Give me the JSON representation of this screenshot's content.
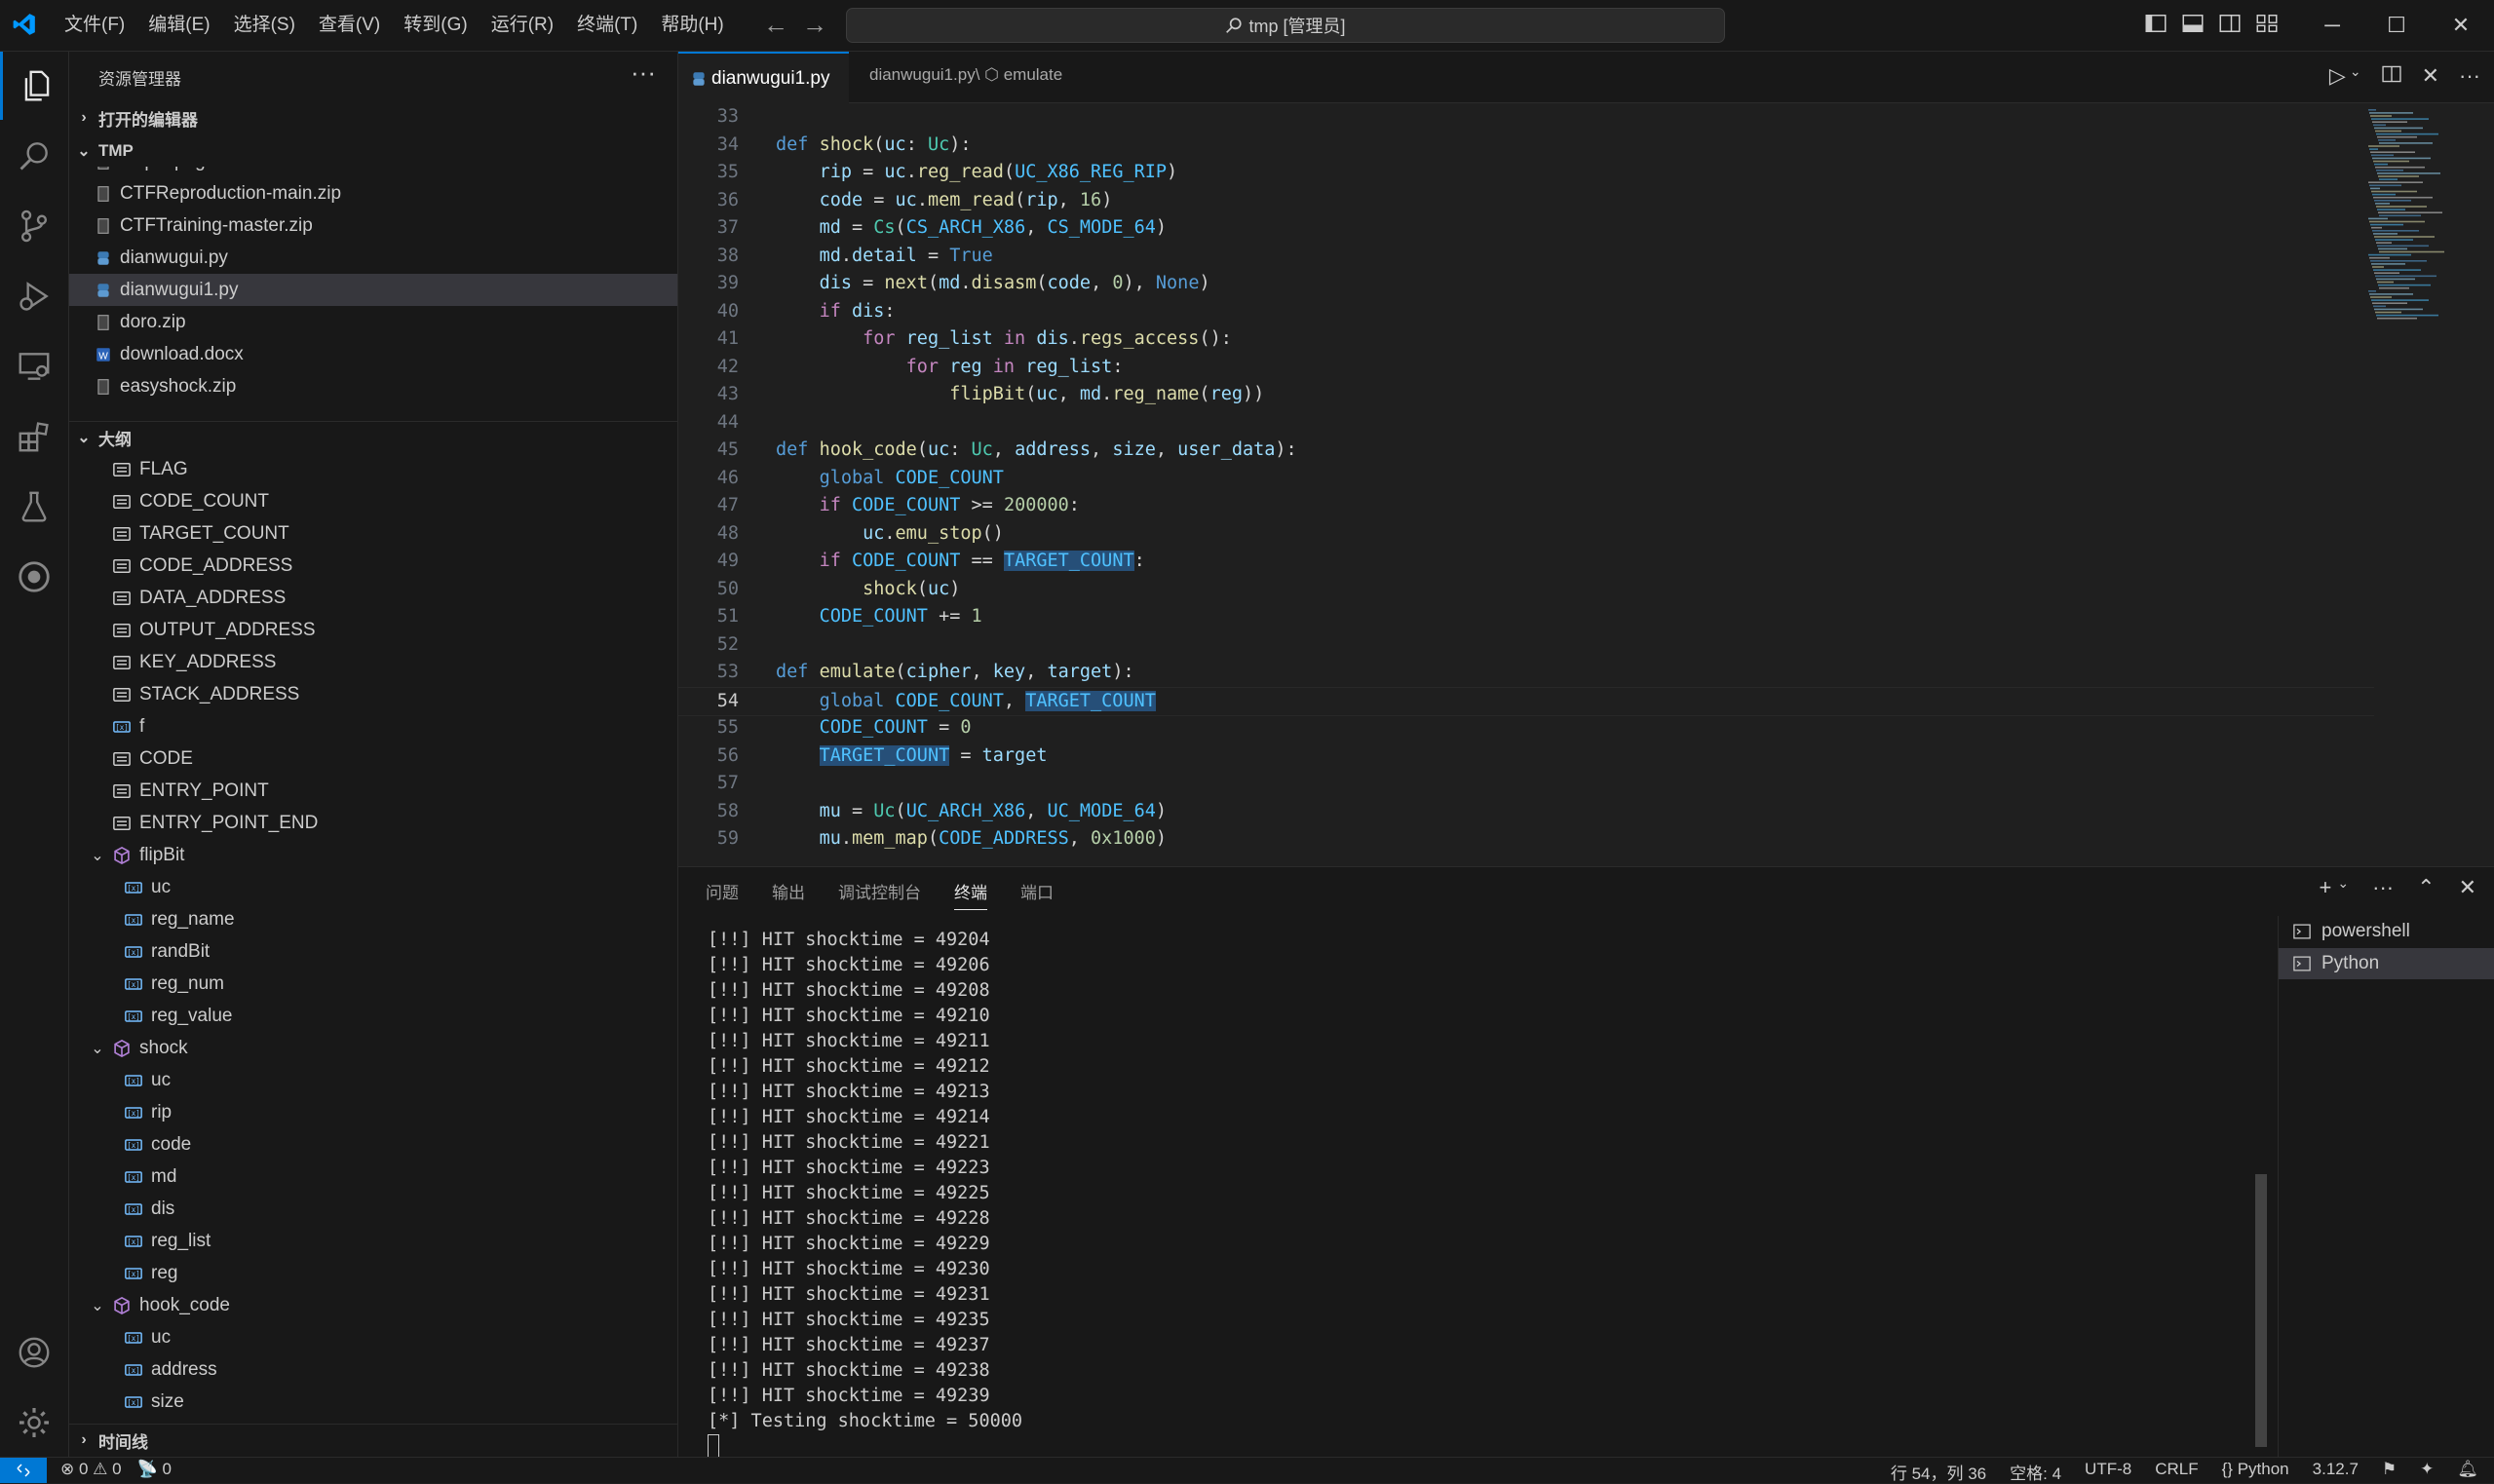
{
  "titlebar": {
    "menus": [
      "文件(F)",
      "编辑(E)",
      "选择(S)",
      "查看(V)",
      "转到(G)",
      "运行(R)",
      "终端(T)",
      "帮助(H)"
    ],
    "nav_back": "←",
    "nav_forward": "→",
    "command_center": "tmp [管理员]",
    "window_controls": [
      "─",
      "☐",
      "✕"
    ]
  },
  "sidebar": {
    "title": "资源管理器",
    "more": "···",
    "open_editors": "打开的编辑器",
    "folder": "TMP",
    "files": [
      {
        "name": "ctf.pcapng",
        "kind": "file"
      },
      {
        "name": "CTFReproduction-main.zip",
        "kind": "zip"
      },
      {
        "name": "CTFTraining-master.zip",
        "kind": "zip"
      },
      {
        "name": "dianwugui.py",
        "kind": "py"
      },
      {
        "name": "dianwugui1.py",
        "kind": "py",
        "selected": true
      },
      {
        "name": "doro.zip",
        "kind": "zip"
      },
      {
        "name": "download.docx",
        "kind": "doc"
      },
      {
        "name": "easyshock.zip",
        "kind": "zip"
      }
    ],
    "outline_title": "大纲",
    "outline": [
      {
        "name": "FLAG",
        "kind": "const",
        "indent": 0
      },
      {
        "name": "CODE_COUNT",
        "kind": "const",
        "indent": 0
      },
      {
        "name": "TARGET_COUNT",
        "kind": "const",
        "indent": 0
      },
      {
        "name": "CODE_ADDRESS",
        "kind": "const",
        "indent": 0
      },
      {
        "name": "DATA_ADDRESS",
        "kind": "const",
        "indent": 0
      },
      {
        "name": "OUTPUT_ADDRESS",
        "kind": "const",
        "indent": 0
      },
      {
        "name": "KEY_ADDRESS",
        "kind": "const",
        "indent": 0
      },
      {
        "name": "STACK_ADDRESS",
        "kind": "const",
        "indent": 0
      },
      {
        "name": "f",
        "kind": "var",
        "indent": 0
      },
      {
        "name": "CODE",
        "kind": "const",
        "indent": 0
      },
      {
        "name": "ENTRY_POINT",
        "kind": "const",
        "indent": 0
      },
      {
        "name": "ENTRY_POINT_END",
        "kind": "const",
        "indent": 0
      },
      {
        "name": "flipBit",
        "kind": "func",
        "indent": 0
      },
      {
        "name": "uc",
        "kind": "var",
        "indent": 1
      },
      {
        "name": "reg_name",
        "kind": "var",
        "indent": 1
      },
      {
        "name": "randBit",
        "kind": "var",
        "indent": 1
      },
      {
        "name": "reg_num",
        "kind": "var",
        "indent": 1
      },
      {
        "name": "reg_value",
        "kind": "var",
        "indent": 1
      },
      {
        "name": "shock",
        "kind": "func",
        "indent": 0
      },
      {
        "name": "uc",
        "kind": "var",
        "indent": 1
      },
      {
        "name": "rip",
        "kind": "var",
        "indent": 1
      },
      {
        "name": "code",
        "kind": "var",
        "indent": 1
      },
      {
        "name": "md",
        "kind": "var",
        "indent": 1
      },
      {
        "name": "dis",
        "kind": "var",
        "indent": 1
      },
      {
        "name": "reg_list",
        "kind": "var",
        "indent": 1
      },
      {
        "name": "reg",
        "kind": "var",
        "indent": 1
      },
      {
        "name": "hook_code",
        "kind": "func",
        "indent": 0
      },
      {
        "name": "uc",
        "kind": "var",
        "indent": 1
      },
      {
        "name": "address",
        "kind": "var",
        "indent": 1
      },
      {
        "name": "size",
        "kind": "var",
        "indent": 1
      }
    ],
    "timeline": "时间线"
  },
  "editor": {
    "tab_name": "dianwugui1.py",
    "breadcrumb": "dianwugui1.py\\ ⬡ emulate",
    "lines": [
      {
        "n": 33,
        "t": [
          [
            "",
            "pl"
          ]
        ]
      },
      {
        "n": 34,
        "t": [
          [
            "def ",
            "kw"
          ],
          [
            "shock",
            "fn"
          ],
          [
            "(",
            "pl"
          ],
          [
            "uc",
            "var"
          ],
          [
            ": ",
            "pl"
          ],
          [
            "Uc",
            "cls"
          ],
          [
            "):",
            "pl"
          ]
        ]
      },
      {
        "n": 35,
        "t": [
          [
            "    ",
            "pl"
          ],
          [
            "rip",
            "var"
          ],
          [
            " = ",
            "pl"
          ],
          [
            "uc",
            "var"
          ],
          [
            ".",
            "pl"
          ],
          [
            "reg_read",
            "fn"
          ],
          [
            "(",
            "pl"
          ],
          [
            "UC_X86_REG_RIP",
            "cst"
          ],
          [
            ")",
            "pl"
          ]
        ]
      },
      {
        "n": 36,
        "t": [
          [
            "    ",
            "pl"
          ],
          [
            "code",
            "var"
          ],
          [
            " = ",
            "pl"
          ],
          [
            "uc",
            "var"
          ],
          [
            ".",
            "pl"
          ],
          [
            "mem_read",
            "fn"
          ],
          [
            "(",
            "pl"
          ],
          [
            "rip",
            "var"
          ],
          [
            ", ",
            "pl"
          ],
          [
            "16",
            "num"
          ],
          [
            ")",
            "pl"
          ]
        ]
      },
      {
        "n": 37,
        "t": [
          [
            "    ",
            "pl"
          ],
          [
            "md",
            "var"
          ],
          [
            " = ",
            "pl"
          ],
          [
            "Cs",
            "cls"
          ],
          [
            "(",
            "pl"
          ],
          [
            "CS_ARCH_X86",
            "cst"
          ],
          [
            ", ",
            "pl"
          ],
          [
            "CS_MODE_64",
            "cst"
          ],
          [
            ")",
            "pl"
          ]
        ]
      },
      {
        "n": 38,
        "t": [
          [
            "    ",
            "pl"
          ],
          [
            "md",
            "var"
          ],
          [
            ".",
            "pl"
          ],
          [
            "detail",
            "var"
          ],
          [
            " = ",
            "pl"
          ],
          [
            "True",
            "kw"
          ]
        ]
      },
      {
        "n": 39,
        "t": [
          [
            "    ",
            "pl"
          ],
          [
            "dis",
            "var"
          ],
          [
            " = ",
            "pl"
          ],
          [
            "next",
            "fn"
          ],
          [
            "(",
            "pl"
          ],
          [
            "md",
            "var"
          ],
          [
            ".",
            "pl"
          ],
          [
            "disasm",
            "fn"
          ],
          [
            "(",
            "pl"
          ],
          [
            "code",
            "var"
          ],
          [
            ", ",
            "pl"
          ],
          [
            "0",
            "num"
          ],
          [
            "), ",
            "pl"
          ],
          [
            "None",
            "kw"
          ],
          [
            ")",
            "pl"
          ]
        ]
      },
      {
        "n": 40,
        "t": [
          [
            "    ",
            "pl"
          ],
          [
            "if ",
            "ctl"
          ],
          [
            "dis",
            "var"
          ],
          [
            ":",
            "pl"
          ]
        ]
      },
      {
        "n": 41,
        "t": [
          [
            "        ",
            "pl"
          ],
          [
            "for ",
            "ctl"
          ],
          [
            "reg_list",
            "var"
          ],
          [
            " in ",
            "ctl"
          ],
          [
            "dis",
            "var"
          ],
          [
            ".",
            "pl"
          ],
          [
            "regs_access",
            "fn"
          ],
          [
            "():",
            "pl"
          ]
        ]
      },
      {
        "n": 42,
        "t": [
          [
            "            ",
            "pl"
          ],
          [
            "for ",
            "ctl"
          ],
          [
            "reg",
            "var"
          ],
          [
            " in ",
            "ctl"
          ],
          [
            "reg_list",
            "var"
          ],
          [
            ":",
            "pl"
          ]
        ]
      },
      {
        "n": 43,
        "t": [
          [
            "                ",
            "pl"
          ],
          [
            "flipBit",
            "fn"
          ],
          [
            "(",
            "pl"
          ],
          [
            "uc",
            "var"
          ],
          [
            ", ",
            "pl"
          ],
          [
            "md",
            "var"
          ],
          [
            ".",
            "pl"
          ],
          [
            "reg_name",
            "fn"
          ],
          [
            "(",
            "pl"
          ],
          [
            "reg",
            "var"
          ],
          [
            "))",
            "pl"
          ]
        ]
      },
      {
        "n": 44,
        "t": [
          [
            "",
            "pl"
          ]
        ]
      },
      {
        "n": 45,
        "t": [
          [
            "def ",
            "kw"
          ],
          [
            "hook_code",
            "fn"
          ],
          [
            "(",
            "pl"
          ],
          [
            "uc",
            "var"
          ],
          [
            ": ",
            "pl"
          ],
          [
            "Uc",
            "cls"
          ],
          [
            ", ",
            "pl"
          ],
          [
            "address",
            "var"
          ],
          [
            ", ",
            "pl"
          ],
          [
            "size",
            "var"
          ],
          [
            ", ",
            "pl"
          ],
          [
            "user_data",
            "var"
          ],
          [
            "):",
            "pl"
          ]
        ]
      },
      {
        "n": 46,
        "t": [
          [
            "    ",
            "pl"
          ],
          [
            "global ",
            "kw"
          ],
          [
            "CODE_COUNT",
            "cst"
          ]
        ]
      },
      {
        "n": 47,
        "t": [
          [
            "    ",
            "pl"
          ],
          [
            "if ",
            "ctl"
          ],
          [
            "CODE_COUNT",
            "cst"
          ],
          [
            " >= ",
            "pl"
          ],
          [
            "200000",
            "num"
          ],
          [
            ":",
            "pl"
          ]
        ]
      },
      {
        "n": 48,
        "t": [
          [
            "        ",
            "pl"
          ],
          [
            "uc",
            "var"
          ],
          [
            ".",
            "pl"
          ],
          [
            "emu_stop",
            "fn"
          ],
          [
            "()",
            "pl"
          ]
        ]
      },
      {
        "n": 49,
        "t": [
          [
            "    ",
            "pl"
          ],
          [
            "if ",
            "ctl"
          ],
          [
            "CODE_COUNT",
            "cst"
          ],
          [
            " == ",
            "pl"
          ],
          [
            "TARGET_COUNT",
            "cst hl"
          ],
          [
            ":",
            "pl"
          ]
        ]
      },
      {
        "n": 50,
        "t": [
          [
            "        ",
            "pl"
          ],
          [
            "shock",
            "fn"
          ],
          [
            "(",
            "pl"
          ],
          [
            "uc",
            "var"
          ],
          [
            ")",
            "pl"
          ]
        ]
      },
      {
        "n": 51,
        "t": [
          [
            "    ",
            "pl"
          ],
          [
            "CODE_COUNT",
            "cst"
          ],
          [
            " += ",
            "pl"
          ],
          [
            "1",
            "num"
          ]
        ]
      },
      {
        "n": 52,
        "t": [
          [
            "",
            "pl"
          ]
        ]
      },
      {
        "n": 53,
        "t": [
          [
            "def ",
            "kw"
          ],
          [
            "emulate",
            "fn"
          ],
          [
            "(",
            "pl"
          ],
          [
            "cipher",
            "var"
          ],
          [
            ", ",
            "pl"
          ],
          [
            "key",
            "var"
          ],
          [
            ", ",
            "pl"
          ],
          [
            "target",
            "var"
          ],
          [
            "):",
            "pl"
          ]
        ]
      },
      {
        "n": 54,
        "t": [
          [
            "    ",
            "pl"
          ],
          [
            "global ",
            "kw"
          ],
          [
            "CODE_COUNT",
            "cst"
          ],
          [
            ", ",
            "pl"
          ],
          [
            "TARGET_COUNT",
            "cst hl"
          ]
        ]
      },
      {
        "n": 55,
        "t": [
          [
            "    ",
            "pl"
          ],
          [
            "CODE_COUNT",
            "cst"
          ],
          [
            " = ",
            "pl"
          ],
          [
            "0",
            "num"
          ]
        ]
      },
      {
        "n": 56,
        "t": [
          [
            "    ",
            "pl"
          ],
          [
            "TARGET_COUNT",
            "cst hl"
          ],
          [
            " = ",
            "pl"
          ],
          [
            "target",
            "var"
          ]
        ]
      },
      {
        "n": 57,
        "t": [
          [
            "",
            "pl"
          ]
        ]
      },
      {
        "n": 58,
        "t": [
          [
            "    ",
            "pl"
          ],
          [
            "mu",
            "var"
          ],
          [
            " = ",
            "pl"
          ],
          [
            "Uc",
            "cls"
          ],
          [
            "(",
            "pl"
          ],
          [
            "UC_ARCH_X86",
            "cst"
          ],
          [
            ", ",
            "pl"
          ],
          [
            "UC_MODE_64",
            "cst"
          ],
          [
            ")",
            "pl"
          ]
        ]
      },
      {
        "n": 59,
        "t": [
          [
            "    ",
            "pl"
          ],
          [
            "mu",
            "var"
          ],
          [
            ".",
            "pl"
          ],
          [
            "mem_map",
            "fn"
          ],
          [
            "(",
            "pl"
          ],
          [
            "CODE_ADDRESS",
            "cst"
          ],
          [
            ", ",
            "pl"
          ],
          [
            "0x1000",
            "num"
          ],
          [
            ")",
            "pl"
          ]
        ]
      }
    ],
    "current_line": 54
  },
  "panel": {
    "tabs": [
      "问题",
      "输出",
      "调试控制台",
      "终端",
      "端口"
    ],
    "active_tab": "终端",
    "terminal_lines": [
      "[!!] HIT shocktime = 49204",
      "[!!] HIT shocktime = 49206",
      "[!!] HIT shocktime = 49208",
      "[!!] HIT shocktime = 49210",
      "[!!] HIT shocktime = 49211",
      "[!!] HIT shocktime = 49212",
      "[!!] HIT shocktime = 49213",
      "[!!] HIT shocktime = 49214",
      "[!!] HIT shocktime = 49221",
      "[!!] HIT shocktime = 49223",
      "[!!] HIT shocktime = 49225",
      "[!!] HIT shocktime = 49228",
      "[!!] HIT shocktime = 49229",
      "[!!] HIT shocktime = 49230",
      "[!!] HIT shocktime = 49231",
      "[!!] HIT shocktime = 49235",
      "[!!] HIT shocktime = 49237",
      "[!!] HIT shocktime = 49238",
      "[!!] HIT shocktime = 49239",
      "[*] Testing shocktime = 50000"
    ],
    "terminals": [
      "powershell",
      "Python"
    ]
  },
  "statusbar": {
    "errors": "⊗ 0 ⚠ 0",
    "ports": "📡 0",
    "position": "行 54，列 36",
    "spaces": "空格: 4",
    "encoding": "UTF-8",
    "eol": "CRLF",
    "language": "{} Python",
    "version": "3.12.7"
  },
  "colors": {
    "accent": "#0078d4",
    "background": "#1f1f1f",
    "sidebar": "#181818"
  }
}
